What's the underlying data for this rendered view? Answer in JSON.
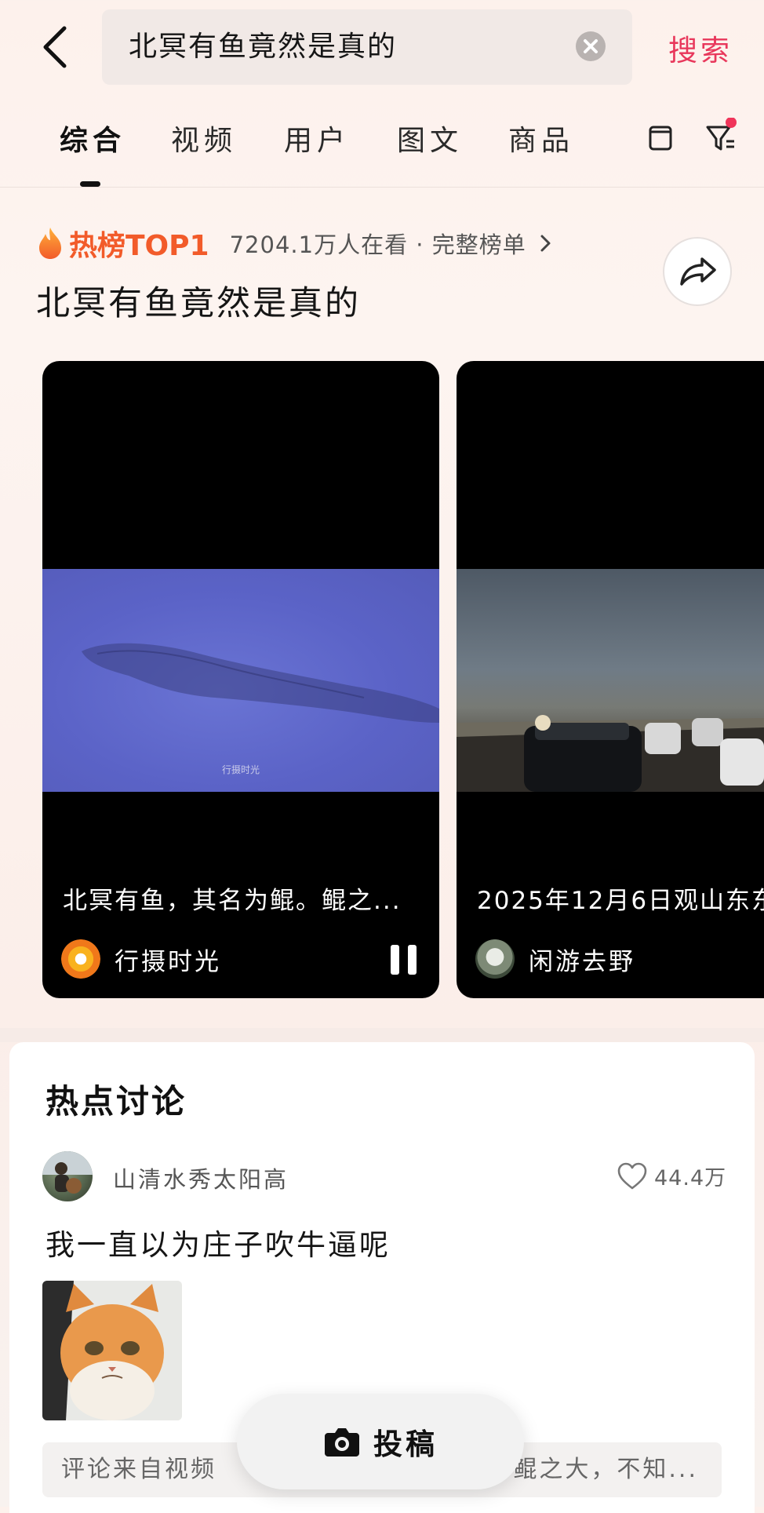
{
  "search": {
    "query": "北冥有鱼竟然是真的",
    "button_label": "搜索"
  },
  "tabs": [
    {
      "label": "综合",
      "active": true
    },
    {
      "label": "视频",
      "active": false
    },
    {
      "label": "用户",
      "active": false
    },
    {
      "label": "图文",
      "active": false
    },
    {
      "label": "商品",
      "active": false
    }
  ],
  "hot": {
    "badge": "热榜TOP1",
    "meta": "7204.1万人在看 · 完整榜单",
    "headline": "北冥有鱼竟然是真的"
  },
  "videos": [
    {
      "title": "北冥有鱼，其名为鲲。鲲之...",
      "author": "行摄时光",
      "watermark": "行摄时光"
    },
    {
      "title": "2025年12月6日观山东东",
      "author": "闲游去野"
    }
  ],
  "discussion": {
    "title": "热点讨论",
    "user": "山清水秀太阳高",
    "likes": "44.4万",
    "comment": "我一直以为庄子吹牛逼呢",
    "source_prefix": "评论来自视频 ",
    "source_tail": "鲲之大，不知..."
  },
  "post_button": {
    "label": "投稿"
  },
  "colors": {
    "accent": "#e8375b",
    "hot": "#f25b2a",
    "notification_dot": "#f0355a"
  },
  "icons": [
    "back-arrow-icon",
    "clear-icon",
    "layout-toggle-icon",
    "filter-icon",
    "flame-icon",
    "share-icon",
    "pause-icon",
    "heart-icon",
    "camera-icon"
  ]
}
